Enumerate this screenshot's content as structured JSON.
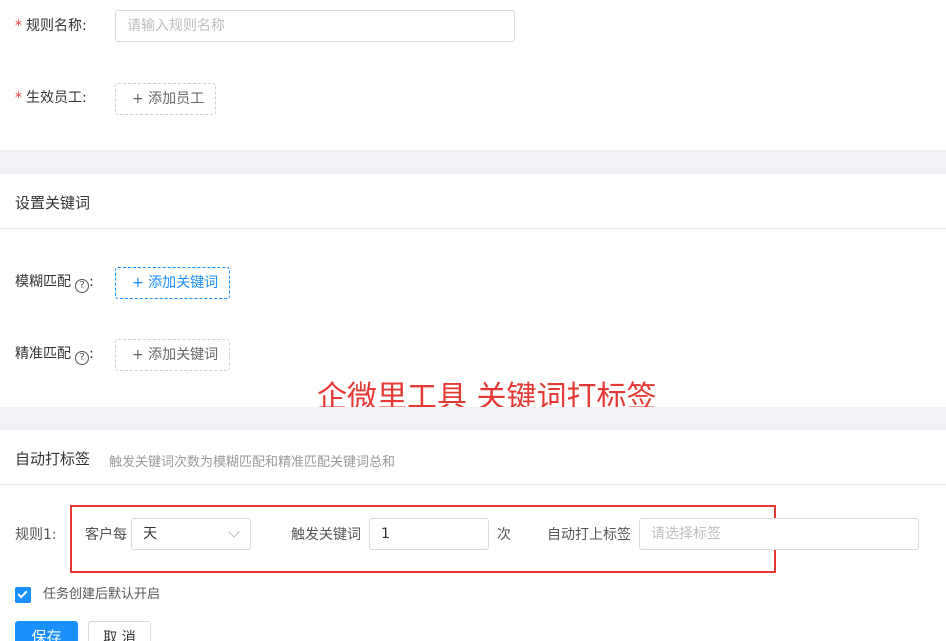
{
  "form": {
    "rule_name": {
      "required_mark": "*",
      "label": "规则名称:",
      "placeholder": "请输入规则名称",
      "value": ""
    },
    "employees": {
      "required_mark": "*",
      "label": "生效员工:",
      "button": "+ 添加员工"
    }
  },
  "keywords": {
    "title": "设置关键词",
    "fuzzy": {
      "label": "模糊匹配",
      "help_icon": "question-circle-icon",
      "colon": ":",
      "button": "+ 添加关键词"
    },
    "exact": {
      "label": "精准匹配",
      "help_icon": "question-circle-icon",
      "colon": ":",
      "button": "+ 添加关键词"
    }
  },
  "watermark": "企微里工具 关键词打标签",
  "auto_tag": {
    "title": "自动打标签",
    "hint": "触发关键词次数为模糊匹配和精准匹配关键词总和",
    "rule": {
      "label": "规则1:",
      "customer_each": "客户每",
      "period_value": "天",
      "trigger_label": "触发关键词",
      "count_value": "1",
      "count_unit": "次",
      "tag_label": "自动打上标签",
      "tag_placeholder": "请选择标签"
    }
  },
  "options": {
    "default_enable": {
      "label": "任务创建后默认开启",
      "checked": true
    }
  },
  "actions": {
    "save": "保存",
    "cancel": "取 消"
  },
  "colors": {
    "primary": "#1890ff",
    "required": "#e53e3e",
    "highlight": "#e53935",
    "band": "#f0f2f5"
  }
}
